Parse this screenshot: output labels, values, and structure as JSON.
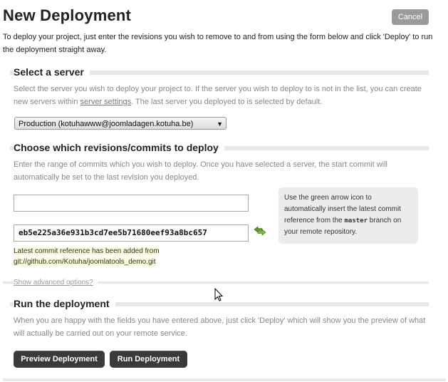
{
  "header": {
    "title": "New Deployment",
    "cancel_label": "Cancel",
    "intro": "To deploy your project, just enter the revisions you wish to remove to and from using the form below and click 'Deploy' to run the deployment straight away."
  },
  "server_section": {
    "title": "Select a server",
    "desc_before": "Select the server you wish to deploy your project to. If the server you wish to deploy to is not in the list, you can create new servers within ",
    "desc_link": "server settings",
    "desc_after": ". The last server you deployed to is selected by default.",
    "selected_server": "Production (kotuhawww@joomladagen.kotuha.be)"
  },
  "revisions_section": {
    "title": "Choose which revisions/commits to deploy",
    "desc": "Enter the range of commits which you wish to deploy. Once you have selected a server, the start commit will automatically be set to the last revision you deployed.",
    "start_revision_value": "",
    "end_revision_value": "eb5e225a36e931b3cd7ee5b71680eef93a8bc657",
    "hint_before": "Use the green arrow icon to automatically insert the latest commit reference from the ",
    "hint_code": "master",
    "hint_after": " branch on your remote repository.",
    "notice": "Latest commit reference has been added from git://github.com/Kotuha/joomlatools_demo.git",
    "advanced_link": "Show advanced options?"
  },
  "run_section": {
    "title": "Run the deployment",
    "desc": "When you are happy with the fields you have entered above, just click 'Deploy' which will show you the preview of what will actually be carried out on your remote service.",
    "preview_label": "Preview Deployment",
    "run_label": "Run Deployment"
  },
  "colors": {
    "accent_green": "#5a9a2a",
    "button_dark": "#3a3a3a",
    "notice_bg": "#fbfbd9"
  },
  "icons": [
    "arrow-exchange-icon",
    "mouse-cursor-icon"
  ]
}
